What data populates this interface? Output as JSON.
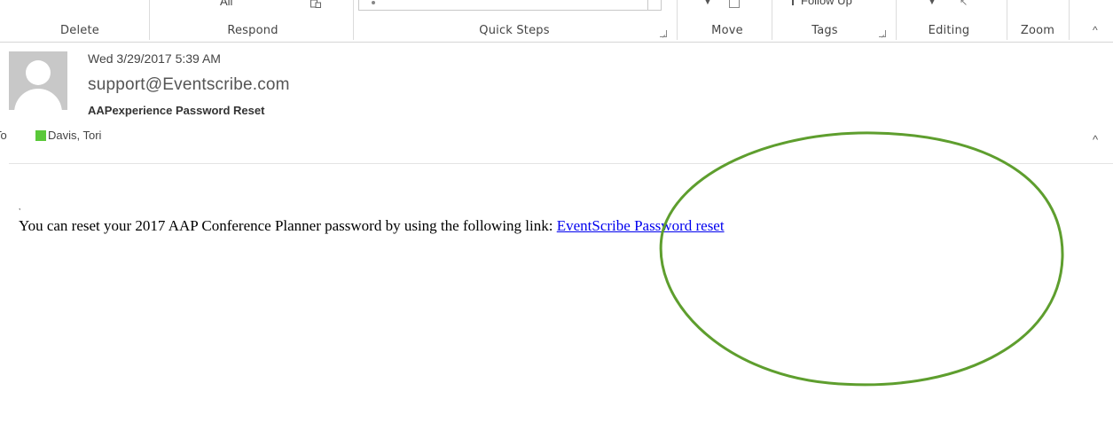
{
  "ribbon": {
    "respond_partial": "All",
    "follow_up_partial": "Follow Up",
    "groups": {
      "delete": "Delete",
      "respond": "Respond",
      "quick_steps": "Quick Steps",
      "move": "Move",
      "tags": "Tags",
      "editing": "Editing",
      "zoom": "Zoom"
    },
    "collapse_glyph": "^"
  },
  "message": {
    "date": "Wed 3/29/2017 5:39 AM",
    "sender": "support@Eventscribe.com",
    "subject": "AAPexperience Password Reset",
    "to_label": "To",
    "recipient": "Davis, Tori",
    "recipient_presence_color": "#5ac839",
    "body_tick": ",",
    "body_text": "You can reset your 2017 AAP Conference Planner password by using the following link: ",
    "link_text": "EventScribe Password reset",
    "link_color": "#0000ee"
  },
  "annotation": {
    "shape": "ellipse",
    "color": "#5e9e2e"
  }
}
